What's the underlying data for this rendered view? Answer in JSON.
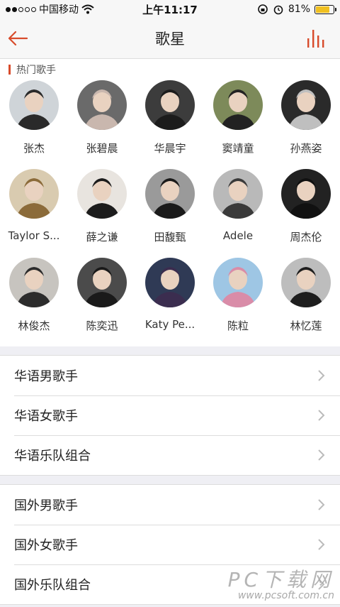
{
  "status": {
    "carrier": "中国移动",
    "time": "上午11:17",
    "battery_percent": "81%",
    "battery_level": 0.81
  },
  "nav": {
    "title": "歌星"
  },
  "hot": {
    "header": "热门歌手",
    "singers": [
      {
        "name": "张杰",
        "bg": "#cfd4d8",
        "fg": "#2a2a2a"
      },
      {
        "name": "张碧晨",
        "bg": "#6a6a6a",
        "fg": "#c9b7ae"
      },
      {
        "name": "华晨宇",
        "bg": "#3c3c3c",
        "fg": "#1c1c1c"
      },
      {
        "name": "窦靖童",
        "bg": "#7d8a5a",
        "fg": "#222222"
      },
      {
        "name": "孙燕姿",
        "bg": "#2a2a2a",
        "fg": "#bfbfbf"
      },
      {
        "name": "Taylor S...",
        "bg": "#d9cbb0",
        "fg": "#8b6b3a"
      },
      {
        "name": "薛之谦",
        "bg": "#e8e4df",
        "fg": "#1c1c1c"
      },
      {
        "name": "田馥甄",
        "bg": "#9a9a9a",
        "fg": "#1a1a1a"
      },
      {
        "name": "Adele",
        "bg": "#b9b9b9",
        "fg": "#3a3a3a"
      },
      {
        "name": "周杰伦",
        "bg": "#222222",
        "fg": "#111111"
      },
      {
        "name": "林俊杰",
        "bg": "#c7c4bf",
        "fg": "#2c2c2c"
      },
      {
        "name": "陈奕迅",
        "bg": "#4b4b4b",
        "fg": "#1a1a1a"
      },
      {
        "name": "Katy Pe...",
        "bg": "#2f3a55",
        "fg": "#3b2d4f"
      },
      {
        "name": "陈粒",
        "bg": "#9ec6e4",
        "fg": "#d98ca8"
      },
      {
        "name": "林忆莲",
        "bg": "#bdbdbd",
        "fg": "#1e1e1e"
      }
    ]
  },
  "groups": [
    [
      {
        "label": "华语男歌手"
      },
      {
        "label": "华语女歌手"
      },
      {
        "label": "华语乐队组合"
      }
    ],
    [
      {
        "label": "国外男歌手"
      },
      {
        "label": "国外女歌手"
      },
      {
        "label": "国外乐队组合"
      }
    ]
  ],
  "watermark": {
    "text": "PC下载网",
    "url": "www.pcsoft.com.cn"
  },
  "colors": {
    "accent": "#d84b2b"
  }
}
